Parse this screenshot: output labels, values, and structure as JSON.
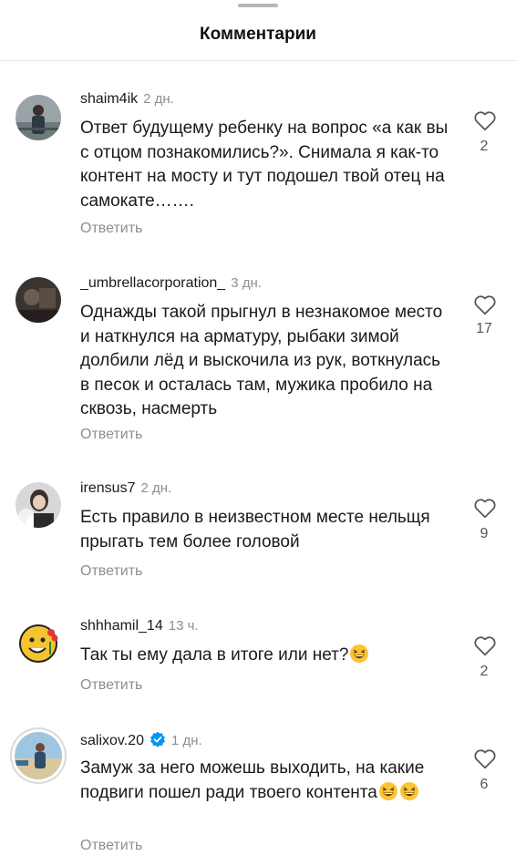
{
  "header": {
    "title": "Комментарии"
  },
  "comments": [
    {
      "username": "shaim4ik",
      "time": "2 дн.",
      "text": "Ответ будущему ребенку на вопрос «а как вы с отцом познакомились?». Снимала я как-то контент на мосту и тут подошел твой отец на самокате…….",
      "reply": "Ответить",
      "likes": "2",
      "avatar": "person-on-bridge"
    },
    {
      "username": "_umbrellacorporation_",
      "time": "3 дн.",
      "text": "Однажды такой прыгнул в незнакомое место и наткнулся на арматуру, рыбаки зимой долбили лёд и выскочила из рук, воткнулась в песок и осталась там, мужика пробило на сквозь, насмерть",
      "reply": "Ответить",
      "likes": "17",
      "avatar": "dark-photo"
    },
    {
      "username": "irensus7",
      "time": "2 дн.",
      "text": "Есть правило в неизвестном месте нельщя прыгать тем более головой",
      "reply": "Ответить",
      "likes": "9",
      "avatar": "woman-with-flowers"
    },
    {
      "username": "shhhamil_14",
      "time": "13 ч.",
      "text": "Так ты ему дала в итоге или нет?",
      "emoji_count": 1,
      "reply": "Ответить",
      "likes": "2",
      "avatar": "cartoon-face-with-roses"
    },
    {
      "username": "salixov.20",
      "verified": true,
      "time": "1 дн.",
      "text": "Замуж за него можешь выходить, на какие подвиги пошел ради твоего контента",
      "emoji_count": 2,
      "reply": "Ответить",
      "likes": "6",
      "avatar": "man-on-beach"
    }
  ],
  "colors": {
    "secondary_text": "#8e8e8e",
    "verified_blue": "#0095f6",
    "story_ring": "#d9d9d9"
  },
  "icons": {
    "like": "heart-outline-icon",
    "verified": "verified-badge-icon",
    "emoji": "grinning-squinting-face-emoji"
  }
}
